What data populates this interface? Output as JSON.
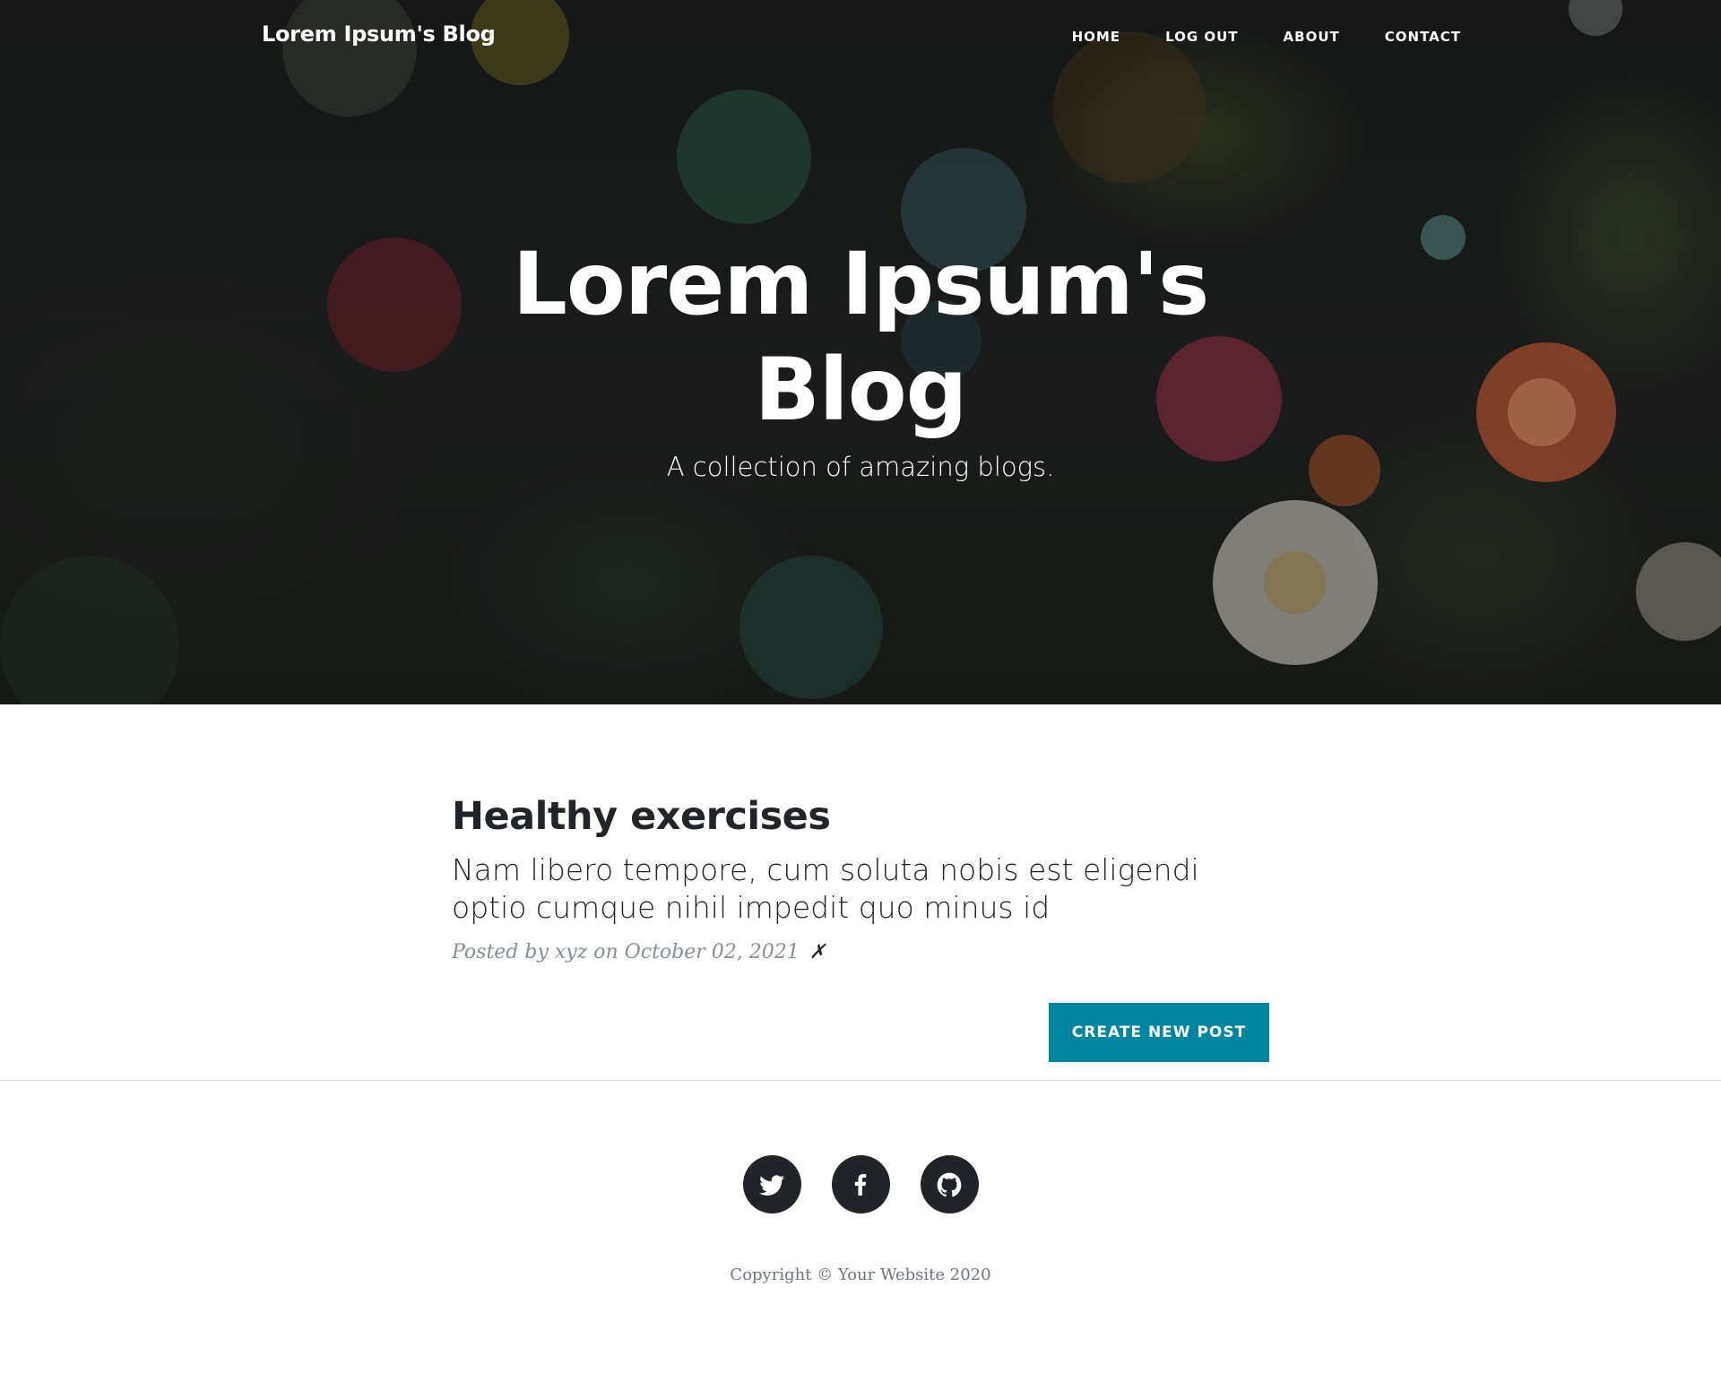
{
  "navbar": {
    "brand": "Lorem Ipsum's Blog",
    "links": [
      "HOME",
      "LOG OUT",
      "ABOUT",
      "CONTACT"
    ]
  },
  "hero": {
    "title": "Lorem Ipsum's Blog",
    "subtitle": "A collection of amazing blogs."
  },
  "post": {
    "title": "Healthy exercises",
    "subtitle": "Nam libero tempore, cum soluta nobis est eligendi optio cumque nihil impedit quo minus id",
    "meta": "Posted by xyz on October 02, 2021",
    "delete_glyph": "✗"
  },
  "actions": {
    "create_label": "CREATE NEW POST"
  },
  "footer": {
    "social": [
      "twitter-icon",
      "facebook-icon",
      "github-icon"
    ],
    "copyright": "Copyright © Your Website 2020"
  },
  "colors": {
    "accent": "#0085a1",
    "dark": "#212529",
    "muted": "#868e96"
  }
}
